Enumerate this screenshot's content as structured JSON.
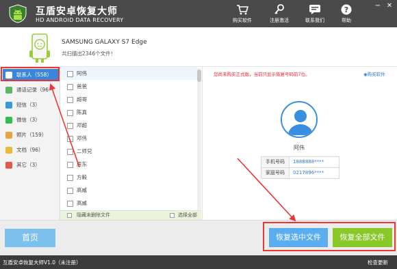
{
  "app": {
    "title": "互盾安卓恢复大师",
    "subtitle": "HD ANDROID DATA RECOVERY",
    "toolbar": [
      {
        "label": "购买软件",
        "icon": "cart-icon"
      },
      {
        "label": "注册激活",
        "icon": "key-icon"
      },
      {
        "label": "联系我们",
        "icon": "chat-icon"
      },
      {
        "label": "帮助",
        "icon": "help-icon"
      }
    ],
    "window_controls": {
      "minimize": "−",
      "close": "✕"
    }
  },
  "device": {
    "name": "SAMSUNG  GALAXY S7 Edge",
    "scan_summary": "共扫描出2346个文件！"
  },
  "sidebar": {
    "items": [
      {
        "label": "联系人（558）",
        "icon": "contacts-icon",
        "color": "#3a86d8",
        "active": true
      },
      {
        "label": "通话记录（96",
        "icon": "phone-icon",
        "color": "#5cb85c"
      },
      {
        "label": "短信（3）",
        "icon": "sms-icon",
        "color": "#3a9ad8"
      },
      {
        "label": "微信（3）",
        "icon": "wechat-icon",
        "color": "#2fbf4a"
      },
      {
        "label": "照片（159）",
        "icon": "photo-icon",
        "color": "#e8a33a"
      },
      {
        "label": "文档（96）",
        "icon": "doc-icon",
        "color": "#e8b93a"
      },
      {
        "label": "其它（3）",
        "icon": "other-icon",
        "color": "#e25b4a"
      }
    ]
  },
  "contact_list": {
    "names": [
      "阿伟",
      "爸爸",
      "超哥",
      "陈真",
      "邓超",
      "邓伟",
      "二师兄",
      "房东",
      "方毅",
      "高威",
      "高威"
    ],
    "hide_deleted_label": "隐藏未删除文件",
    "select_all_label": "选择全部"
  },
  "detail": {
    "notice": "您尚未购买正式版，当前只显示恢复号码前7位。",
    "buy_link": "购买软件",
    "contact_name": "阿伟",
    "fields": [
      {
        "label": "手机号码",
        "value": "1888888****"
      },
      {
        "label": "家庭号码",
        "value": "0217896****"
      }
    ]
  },
  "buttons": {
    "home": "首页",
    "recover_selected": "恢复选中文件",
    "recover_all": "恢复全部文件"
  },
  "status": {
    "left": "互盾安卓恢复大师V1.0（未注册）",
    "right": "检查更新"
  },
  "colors": {
    "accent_blue": "#3a86d8",
    "recover_green": "#8ac82a",
    "annotation_red": "#e33333"
  }
}
